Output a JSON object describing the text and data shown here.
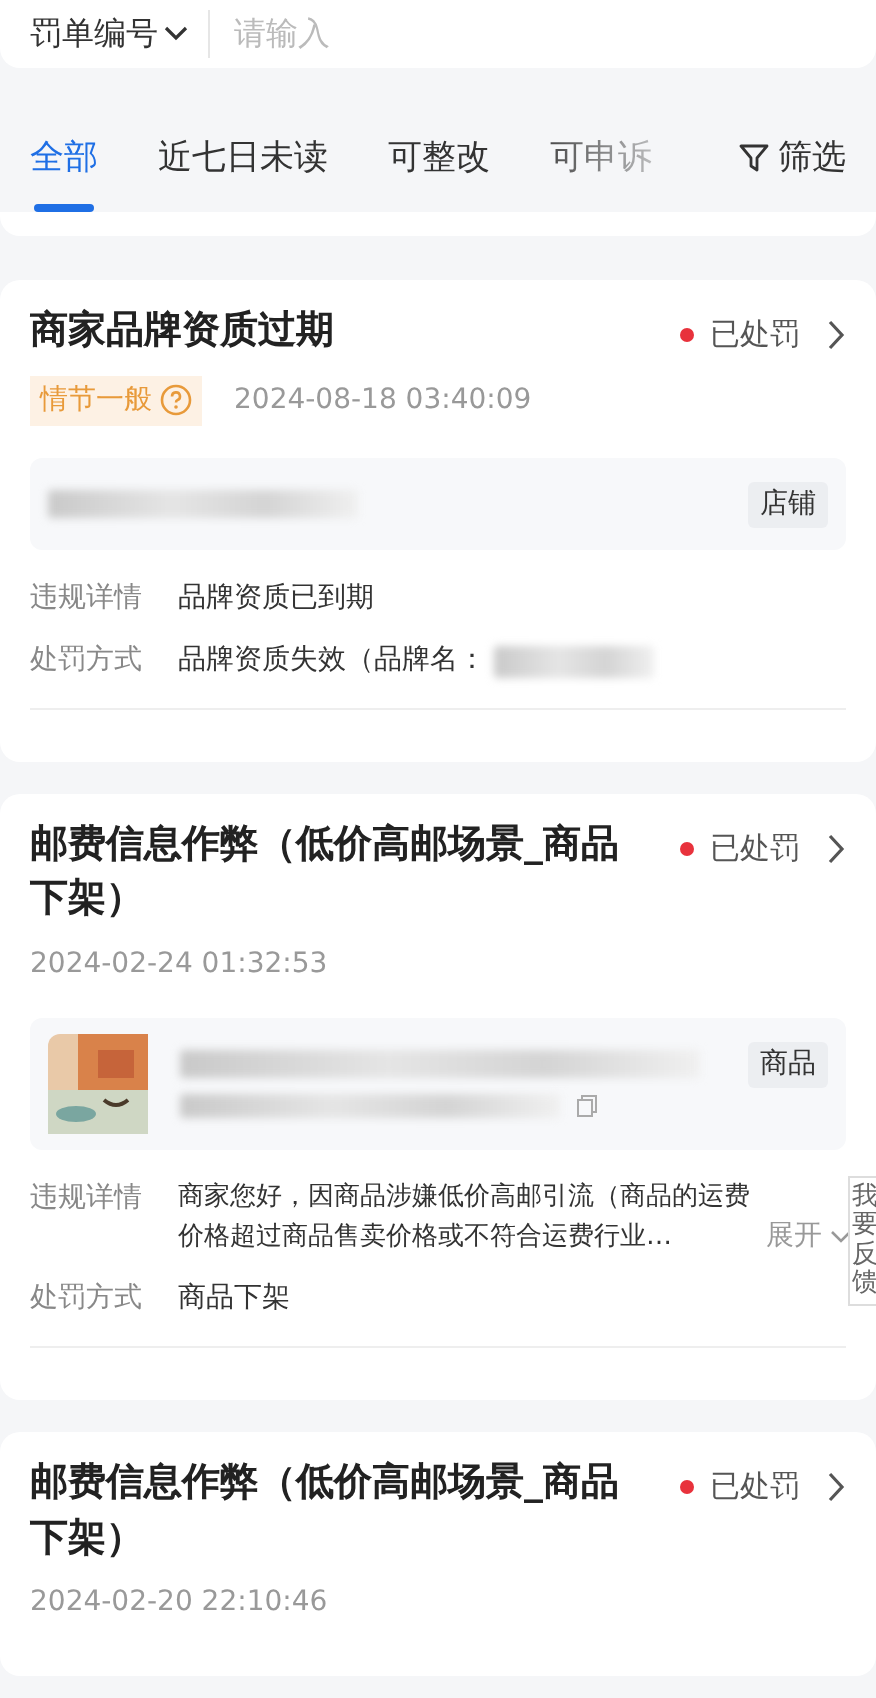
{
  "search": {
    "filter_label": "罚单编号",
    "placeholder": "请输入"
  },
  "tabs": [
    {
      "label": "全部",
      "selected": true
    },
    {
      "label": "近七日未读",
      "selected": false
    },
    {
      "label": "可整改",
      "selected": false
    },
    {
      "label": "可申诉",
      "selected": false
    }
  ],
  "filter_button": "筛选",
  "cards": [
    {
      "title": "商家品牌资质过期",
      "status": "已处罚",
      "severity": "情节一般",
      "time": "2024-08-18 03:40:09",
      "target": {
        "kind": "shop",
        "tag": "店铺"
      },
      "details": [
        {
          "label": "违规详情",
          "value": "品牌资质已到期"
        },
        {
          "label": "处罚方式",
          "value": "品牌资质失效（品牌名：",
          "blurred_tail": true
        }
      ]
    },
    {
      "title": "邮费信息作弊（低价高邮场景_商品下架）",
      "status": "已处罚",
      "time": "2024-02-24 01:32:53",
      "target": {
        "kind": "product",
        "tag": "商品"
      },
      "details": [
        {
          "label": "违规详情",
          "value": "商家您好，因商品涉嫌低价高邮引流（商品的运费价格超过商品售卖价格或不符合运费行业…",
          "expand": "展开"
        },
        {
          "label": "处罚方式",
          "value": "商品下架"
        }
      ]
    },
    {
      "title": "邮费信息作弊（低价高邮场景_商品下架）",
      "status": "已处罚",
      "time": "2024-02-20 22:10:46"
    }
  ],
  "feedback_tab": "我要反馈"
}
